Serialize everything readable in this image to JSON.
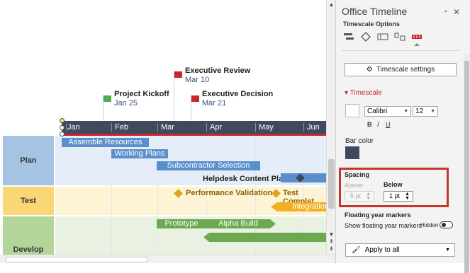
{
  "timeline": {
    "months": [
      "Jan",
      "Feb",
      "Mar",
      "Apr",
      "May",
      "Jun"
    ],
    "lanes": [
      {
        "label": "Plan",
        "bg": "#e4edf8",
        "labelbg": "#a6c3e4"
      },
      {
        "label": "Test",
        "bg": "#fdf3d5",
        "labelbg": "#f9d775"
      },
      {
        "label": "Develop",
        "bg": "#e9f2e1",
        "labelbg": "#b3d59a"
      }
    ],
    "milestones_flags": [
      {
        "title": "Project Kickoff",
        "date": "Jan 25",
        "color": "#4caf50"
      },
      {
        "title": "Executive Review",
        "date": "Mar 10",
        "color": "#c8262e"
      },
      {
        "title": "Executive Decision",
        "date": "Mar 21",
        "color": "#c8262e"
      }
    ],
    "tasks": {
      "assemble": "Assemble Resources",
      "working": "Working Plans",
      "subcontractor": "Subcontractor Selection",
      "helpdesk": "Helpdesk Content Plan",
      "integration": "Integration",
      "prototype": "Prototype",
      "alpha": "Alpha Build"
    },
    "test_milestones": {
      "performance": "Performance Validation",
      "test_complete": "Test Complet"
    }
  },
  "panel": {
    "title": "Office Timeline",
    "subtitle": "Timescale Options",
    "settings_button": "Timescale settings",
    "section": "Timescale",
    "font": "Calibri",
    "size": "12",
    "bold": "B",
    "italic": "I",
    "underline": "U",
    "bar_color_label": "Bar color",
    "spacing_label": "Spacing",
    "above_label": "Above",
    "below_label": "Below",
    "above_value": "5 pt",
    "below_value": "1 pt",
    "floating_label": "Floating year markers",
    "show_floating_label": "Show floating year markers",
    "hidden_label": "Hidden",
    "apply_label": "Apply to all",
    "accent": "#c8262e",
    "bar_color": "#3f4a5c"
  }
}
